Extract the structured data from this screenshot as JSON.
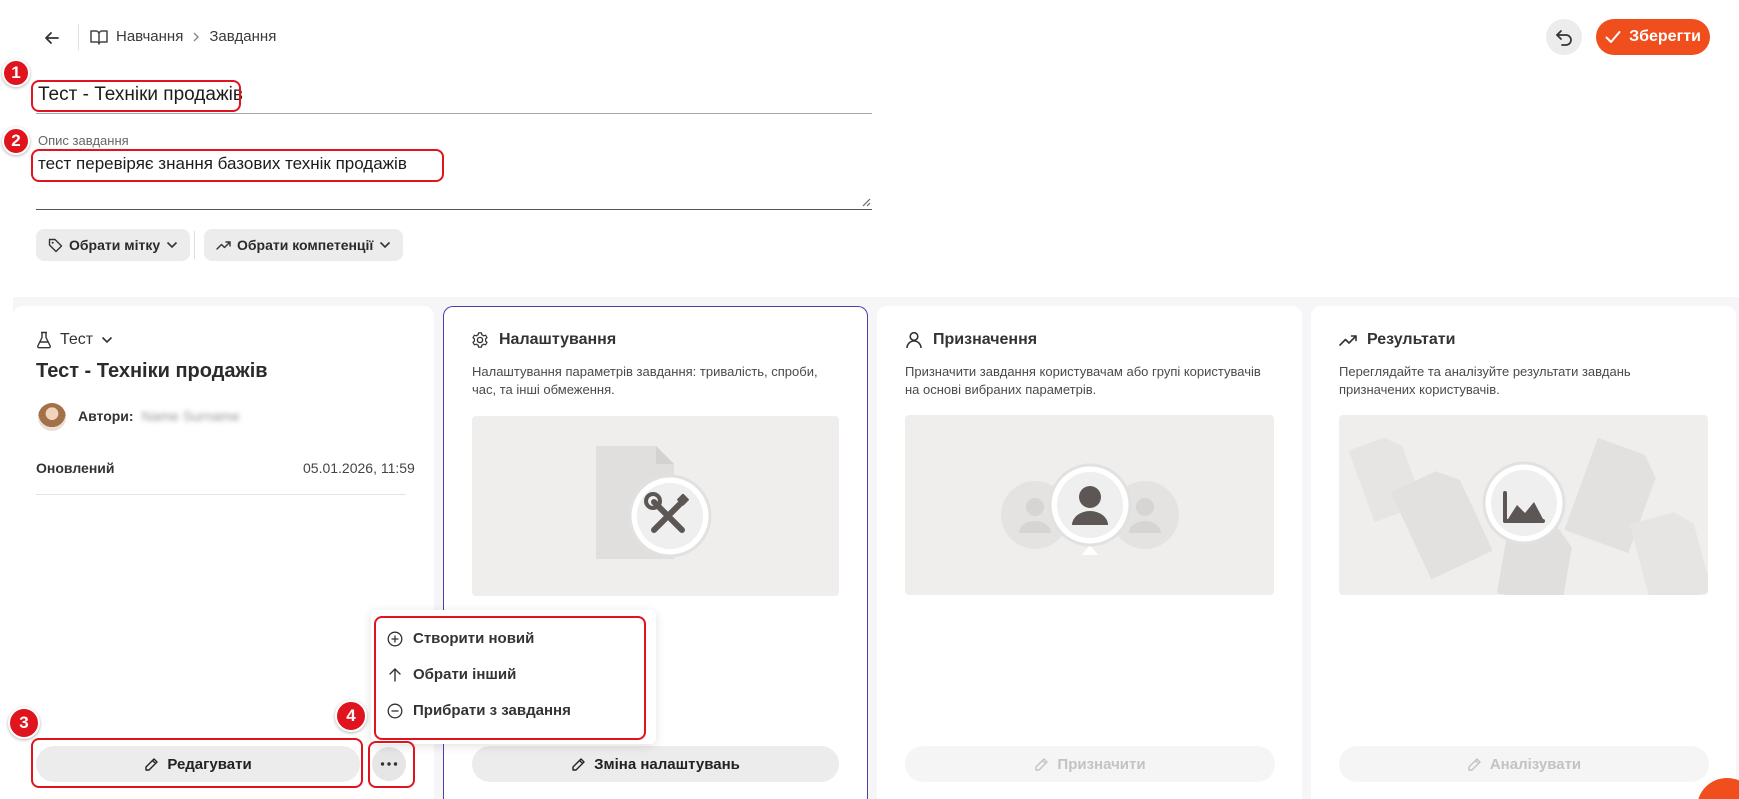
{
  "header": {
    "breadcrumb": {
      "root": "Навчання",
      "current": "Завдання"
    },
    "save_label": "Зберегти"
  },
  "task": {
    "title": "Тест - Техніки продажів",
    "description_label": "Опис завдання",
    "description": "тест перевіряє знання базових технік продажів"
  },
  "chips": {
    "tag": "Обрати мітку",
    "competencies": "Обрати компетенції"
  },
  "test_card": {
    "type": "Тест",
    "title": "Тест - Техніки продажів",
    "authors_label": "Автори:",
    "author_name": "Name Surname",
    "updated_label": "Оновлений",
    "updated_value": "05.01.2026, 11:59",
    "edit_label": "Редагувати"
  },
  "settings_card": {
    "title": "Налаштування",
    "description": "Налаштування параметрів завдання: тривалість, спроби, час, та інші обмеження.",
    "button": "Зміна налаштувань"
  },
  "assign_card": {
    "title": "Призначення",
    "description": "Призначити завдання користувачам або групі користувачів на основі вибраних параметрів.",
    "button": "Призначити"
  },
  "results_card": {
    "title": "Результати",
    "description": "Переглядайте та аналізуйте результати завдань призначених користувачів.",
    "button": "Аналізувати"
  },
  "context_menu": {
    "items": [
      {
        "label": "Створити новий",
        "icon": "plus-circle-icon"
      },
      {
        "label": "Обрати інший",
        "icon": "arrow-up-icon"
      },
      {
        "label": "Прибрати з завдання",
        "icon": "minus-circle-icon"
      }
    ]
  },
  "annotations": [
    "1",
    "2",
    "3",
    "4"
  ],
  "colors": {
    "accent": "#f04e1c",
    "highlight": "#e0141e",
    "selected_border": "#4b3fa8"
  }
}
